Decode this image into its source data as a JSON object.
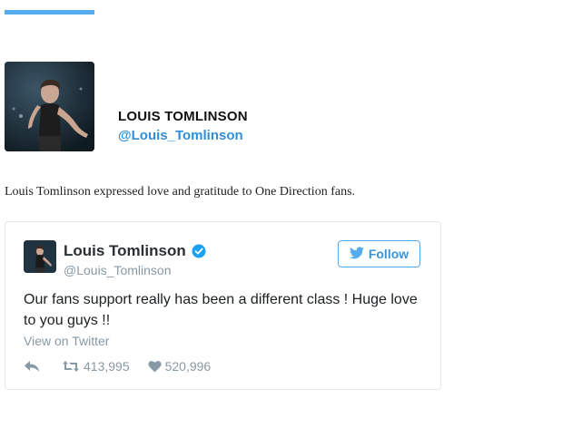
{
  "profile": {
    "name": "LOUIS TOMLINSON",
    "handle": "@Louis_Tomlinson"
  },
  "caption": "Louis Tomlinson expressed love and gratitude to One Direction fans.",
  "tweet": {
    "author_name": "Louis Tomlinson",
    "author_handle": "@Louis_Tomlinson",
    "verified": true,
    "follow_label": "Follow",
    "text": "Our fans support really has been a different class ! Huge love to you guys !!",
    "view_link": "View on Twitter",
    "retweets": "413,995",
    "likes": "520,996"
  },
  "icons": {
    "reply": "reply-icon",
    "retweet": "retweet-icon",
    "like": "heart-icon",
    "verified": "verified-badge-icon",
    "follow": "twitter-bird-icon"
  },
  "colors": {
    "accent": "#55acee",
    "link": "#2f8fd8",
    "muted": "#8899a6"
  }
}
